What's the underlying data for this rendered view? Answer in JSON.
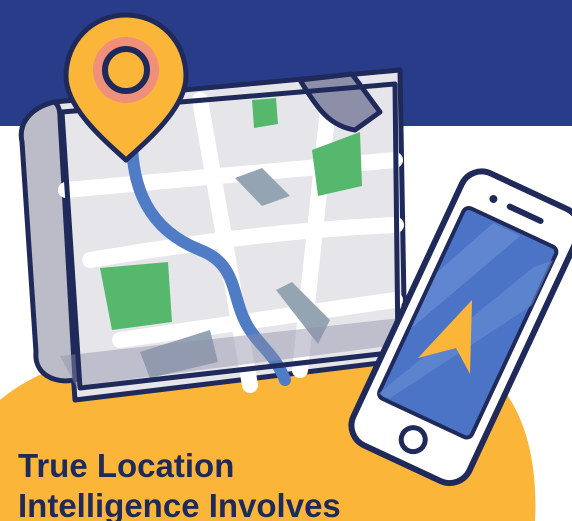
{
  "headline": {
    "line1": "True Location",
    "line2": "Intelligence Involves"
  },
  "colors": {
    "header_band": "#283c8a",
    "orange_blob": "#fbb63a",
    "outline": "#1f2a5a",
    "map_paper": "#e6e6ea",
    "map_fold": "#bcbcc8",
    "map_fold_dark": "#8d8fa8",
    "road": "#ffffff",
    "river": "#4f7cc4",
    "park": "#55b86d",
    "building": "#94a4b2",
    "pin": "#fbb63a",
    "pin_inner": "#f08f7a",
    "phone_body": "#ffffff",
    "phone_screen": "#4b73c6",
    "screen_streak": "#6b8fd6",
    "nav_arrow": "#fbb63a",
    "text": "#1f2a5a"
  },
  "icons": {
    "pin": "map-pin-icon",
    "arrow": "navigation-arrow-icon"
  }
}
